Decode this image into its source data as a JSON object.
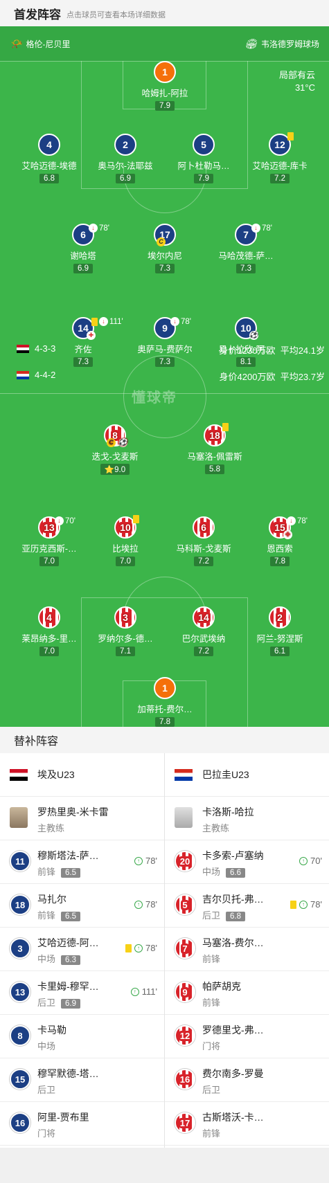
{
  "header": {
    "title": "首发阵容",
    "subtitle": "点击球员可查看本场详细数据"
  },
  "venue": {
    "left": "格伦-尼贝里",
    "right": "韦洛德罗姆球场",
    "weather_desc": "局部有云",
    "weather_temp": "31°C"
  },
  "home_formation": {
    "shape": "4-3-3",
    "value": "身价1230万欧",
    "age": "平均24.1岁"
  },
  "away_formation": {
    "shape": "4-4-2",
    "value": "身价4200万欧",
    "age": "平均23.7岁"
  },
  "watermark": "懂球帝",
  "home_players": [
    {
      "num": "1",
      "name": "哈姆扎-阿拉",
      "rating": "7.9"
    },
    {
      "num": "4",
      "name": "艾哈迈德-埃德",
      "rating": "6.8"
    },
    {
      "num": "2",
      "name": "奥马尔-法耶兹",
      "rating": "6.9"
    },
    {
      "num": "5",
      "name": "阿卜杜勒马…",
      "rating": "7.9"
    },
    {
      "num": "12",
      "name": "艾哈迈德-库卡",
      "rating": "7.2"
    },
    {
      "num": "6",
      "name": "谢哈塔",
      "rating": "6.9",
      "min": "78'"
    },
    {
      "num": "17",
      "name": "埃尔内尼",
      "rating": "7.3"
    },
    {
      "num": "7",
      "name": "马哈茂德-萨…",
      "rating": "7.3",
      "min": "78'"
    },
    {
      "num": "14",
      "name": "齐佐",
      "rating": "7.3",
      "min": "111'"
    },
    {
      "num": "9",
      "name": "奥萨马-费萨尔",
      "rating": "7.3",
      "min": "78'"
    },
    {
      "num": "10",
      "name": "易卜拉欣-阿…",
      "rating": "8.1"
    }
  ],
  "away_players": [
    {
      "num": "8",
      "name": "迭戈-戈麦斯",
      "rating": "9.0"
    },
    {
      "num": "18",
      "name": "马塞洛-佩雷斯",
      "rating": "5.8"
    },
    {
      "num": "13",
      "name": "亚历克西斯-…",
      "rating": "7.0",
      "min": "70'"
    },
    {
      "num": "10",
      "name": "比埃拉",
      "rating": "7.0"
    },
    {
      "num": "6",
      "name": "马科斯-戈麦斯",
      "rating": "7.2"
    },
    {
      "num": "15",
      "name": "恩西索",
      "rating": "7.8",
      "min": "78'"
    },
    {
      "num": "4",
      "name": "莱昂纳多-里…",
      "rating": "7.0"
    },
    {
      "num": "3",
      "name": "罗纳尔多-德…",
      "rating": "7.1"
    },
    {
      "num": "14",
      "name": "巴尔武埃纳",
      "rating": "7.2"
    },
    {
      "num": "2",
      "name": "阿兰-努涅斯",
      "rating": "6.1"
    },
    {
      "num": "1",
      "name": "加蒂托-费尔…",
      "rating": "7.8"
    }
  ],
  "subs_title": "替补阵容",
  "home_team": {
    "name": "埃及U23",
    "coach": "罗热里奥-米卡雷",
    "coach_role": "主教练",
    "subs": [
      {
        "num": "11",
        "name": "穆斯塔法-萨…",
        "pos": "前锋",
        "rating": "6.5",
        "min": "78'"
      },
      {
        "num": "18",
        "name": "马扎尔",
        "pos": "前锋",
        "rating": "6.5",
        "min": "78'"
      },
      {
        "num": "3",
        "name": "艾哈迈德-阿…",
        "pos": "中场",
        "rating": "6.3",
        "min": "78'"
      },
      {
        "num": "13",
        "name": "卡里姆-穆罕…",
        "pos": "后卫",
        "rating": "6.9",
        "min": "111'"
      },
      {
        "num": "8",
        "name": "卡马勒",
        "pos": "中场"
      },
      {
        "num": "15",
        "name": "穆罕默德-塔…",
        "pos": "后卫"
      },
      {
        "num": "16",
        "name": "阿里-贾布里",
        "pos": "门将"
      }
    ]
  },
  "away_team": {
    "name": "巴拉圭U23",
    "coach": "卡洛斯-哈拉",
    "coach_role": "主教练",
    "subs": [
      {
        "num": "20",
        "name": "卡多索-卢塞纳",
        "pos": "中场",
        "rating": "6.6",
        "min": "70'"
      },
      {
        "num": "5",
        "name": "吉尔贝托-弗…",
        "pos": "后卫",
        "rating": "6.8",
        "min": "78'"
      },
      {
        "num": "7",
        "name": "马塞洛-费尔…",
        "pos": "前锋"
      },
      {
        "num": "9",
        "name": "帕萨胡克",
        "pos": "前锋"
      },
      {
        "num": "12",
        "name": "罗德里戈-弗…",
        "pos": "门将"
      },
      {
        "num": "16",
        "name": "费尔南多-罗曼",
        "pos": "后卫"
      },
      {
        "num": "17",
        "name": "古斯塔沃-卡…",
        "pos": "前锋"
      }
    ]
  }
}
